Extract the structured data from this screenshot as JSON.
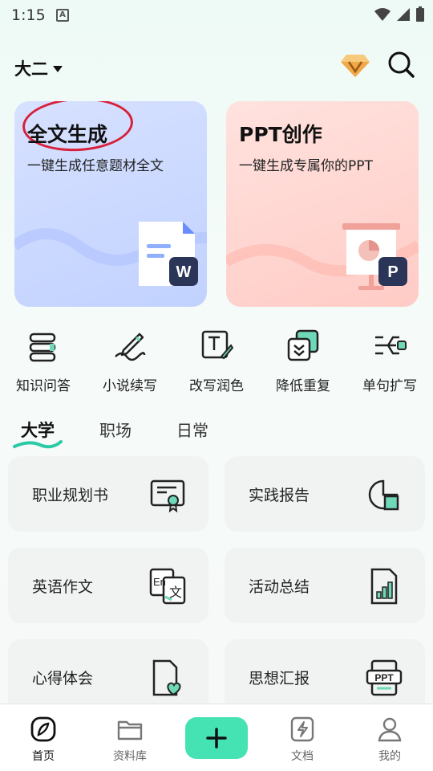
{
  "status_bar": {
    "time": "1:15",
    "notification_icon": "a-box-icon"
  },
  "header": {
    "grade_selector": "大二",
    "vip_icon": "diamond-icon",
    "search_icon": "search-icon"
  },
  "feature_cards": [
    {
      "title": "全文生成",
      "subtitle": "一键生成任意题材全文",
      "badge": "W"
    },
    {
      "title": "PPT创作",
      "subtitle": "一键生成专属你的PPT",
      "badge": "P"
    }
  ],
  "quick_actions": [
    {
      "label": "知识问答",
      "icon": "books-icon"
    },
    {
      "label": "小说续写",
      "icon": "pen-squiggle-icon"
    },
    {
      "label": "改写润色",
      "icon": "text-edit-icon"
    },
    {
      "label": "降低重复",
      "icon": "layers-down-icon"
    },
    {
      "label": "单句扩写",
      "icon": "branch-icon"
    }
  ],
  "category_tabs": [
    {
      "label": "大学",
      "active": true
    },
    {
      "label": "职场",
      "active": false
    },
    {
      "label": "日常",
      "active": false
    }
  ],
  "templates": [
    {
      "label": "职业规划书",
      "icon": "certificate-icon"
    },
    {
      "label": "实践报告",
      "icon": "pie-report-icon"
    },
    {
      "label": "英语作文",
      "icon": "translate-icon"
    },
    {
      "label": "活动总结",
      "icon": "bar-doc-icon"
    },
    {
      "label": "心得体会",
      "icon": "heart-doc-icon"
    },
    {
      "label": "思想汇报",
      "icon": "ppt-doc-icon"
    }
  ],
  "bottom_nav": {
    "home": "首页",
    "library": "资料库",
    "docs": "文档",
    "mine": "我的"
  },
  "colors": {
    "accent": "#45e2b4",
    "card_blue": "#cad8ff",
    "card_pink": "#ffd5d0",
    "word_badge": "#2a3557",
    "annotation": "#d8203a"
  }
}
